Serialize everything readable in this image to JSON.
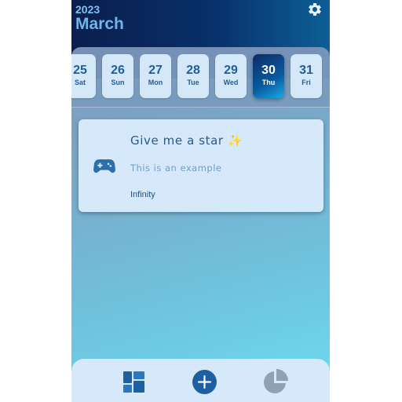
{
  "header": {
    "year": "2023",
    "month": "March",
    "settings_icon": "gear-icon"
  },
  "days": [
    {
      "num": "25",
      "weekday": "Sat",
      "selected": false
    },
    {
      "num": "26",
      "weekday": "Sun",
      "selected": false
    },
    {
      "num": "27",
      "weekday": "Mon",
      "selected": false
    },
    {
      "num": "28",
      "weekday": "Tue",
      "selected": false
    },
    {
      "num": "29",
      "weekday": "Wed",
      "selected": false
    },
    {
      "num": "30",
      "weekday": "Thu",
      "selected": true
    },
    {
      "num": "31",
      "weekday": "Fri",
      "selected": false
    }
  ],
  "habit_card": {
    "icon": "gamepad-icon",
    "title": "Give me a star ✨",
    "subtitle": "This is an example",
    "duration": "Infinity"
  },
  "bottom_nav": {
    "items": [
      "dashboard-icon",
      "add-circle-icon",
      "pie-chart-icon"
    ]
  },
  "colors": {
    "header_dark": "#0b1e4d",
    "accent": "#1f5e9c",
    "card_bg": "#d6e9fa",
    "selected_day": "#0a5a9e"
  }
}
